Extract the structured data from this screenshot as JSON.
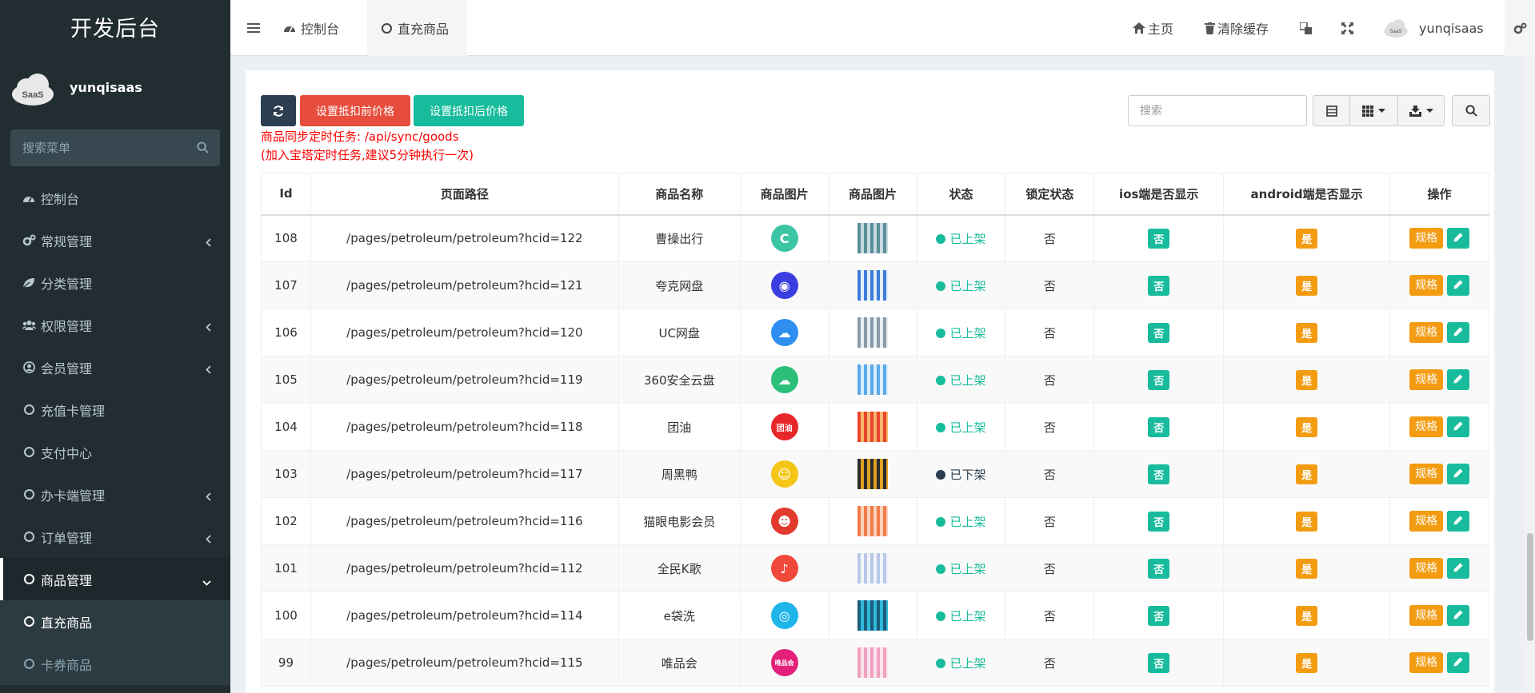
{
  "sidebar": {
    "logo": "开发后台",
    "username": "yunqisaas",
    "avatar_text": "SaaS",
    "search_placeholder": "搜索菜单",
    "items": [
      {
        "label": "控制台",
        "icon": "dashboard-icon",
        "chevron": false
      },
      {
        "label": "常规管理",
        "icon": "cogs-icon",
        "chevron": "left"
      },
      {
        "label": "分类管理",
        "icon": "leaf-icon",
        "chevron": false
      },
      {
        "label": "权限管理",
        "icon": "group-icon",
        "chevron": "left"
      },
      {
        "label": "会员管理",
        "icon": "user-circle-icon",
        "chevron": "left"
      },
      {
        "label": "充值卡管理",
        "icon": "circle-icon",
        "chevron": false
      },
      {
        "label": "支付中心",
        "icon": "circle-icon",
        "chevron": false
      },
      {
        "label": "办卡端管理",
        "icon": "circle-icon",
        "chevron": "left"
      },
      {
        "label": "订单管理",
        "icon": "circle-icon",
        "chevron": "left"
      },
      {
        "label": "商品管理",
        "icon": "circle-icon",
        "chevron": "down",
        "active": true
      },
      {
        "label": "直充商品",
        "icon": "circle-icon",
        "chevron": false,
        "sub": true,
        "current": true
      },
      {
        "label": "卡券商品",
        "icon": "circle-icon",
        "chevron": false,
        "sub": true
      }
    ]
  },
  "header": {
    "tabs": [
      {
        "label": "控制台",
        "icon": "dashboard-icon"
      },
      {
        "label": "直充商品",
        "icon": "circle-icon",
        "active": true
      }
    ],
    "home_label": "主页",
    "clear_cache_label": "清除缓存",
    "username": "yunqisaas"
  },
  "toolbar": {
    "set_before_label": "设置抵扣前价格",
    "set_after_label": "设置抵扣后价格",
    "note_line1": "商品同步定时任务: /api/sync/goods",
    "note_line2": "(加入宝塔定时任务,建议5分钟执行一次)",
    "search_placeholder": "搜索"
  },
  "table": {
    "headers": [
      "Id",
      "页面路径",
      "商品名称",
      "商品图片",
      "商品图片",
      "状态",
      "锁定状态",
      "ios端是否显示",
      "android端是否显示",
      "操作"
    ],
    "spec_label": "规格",
    "rows": [
      {
        "id": "108",
        "path": "/pages/petroleum/petroleum?hcid=122",
        "name": "曹操出行",
        "logo_color": "#3cc5a5",
        "logo_text": "C",
        "thumb": [
          "#5a8f9a",
          "#c9d9e0"
        ],
        "status": "已上架",
        "status_color": "#18bc9c",
        "locked": "否",
        "ios": "否",
        "android": "是"
      },
      {
        "id": "107",
        "path": "/pages/petroleum/petroleum?hcid=121",
        "name": "夸克网盘",
        "logo_color": "#3a3ee0",
        "logo_text": "◉",
        "thumb": [
          "#3d7bd9",
          "#e3eefb"
        ],
        "status": "已上架",
        "status_color": "#18bc9c",
        "locked": "否",
        "ios": "否",
        "android": "是"
      },
      {
        "id": "106",
        "path": "/pages/petroleum/petroleum?hcid=120",
        "name": "UC网盘",
        "logo_color": "#2f8ff0",
        "logo_text": "☁",
        "thumb": [
          "#8a99a8",
          "#e6edf3"
        ],
        "status": "已上架",
        "status_color": "#18bc9c",
        "locked": "否",
        "ios": "否",
        "android": "是"
      },
      {
        "id": "105",
        "path": "/pages/petroleum/petroleum?hcid=119",
        "name": "360安全云盘",
        "logo_color": "#2bbf7a",
        "logo_text": "☁",
        "thumb": [
          "#5aa9e8",
          "#dbeefc"
        ],
        "status": "已上架",
        "status_color": "#18bc9c",
        "locked": "否",
        "ios": "否",
        "android": "是"
      },
      {
        "id": "104",
        "path": "/pages/petroleum/petroleum?hcid=118",
        "name": "团油",
        "logo_color": "#e8272b",
        "logo_text": "团油",
        "thumb": [
          "#e8442c",
          "#f7b56b"
        ],
        "status": "已上架",
        "status_color": "#18bc9c",
        "locked": "否",
        "ios": "否",
        "android": "是"
      },
      {
        "id": "103",
        "path": "/pages/petroleum/petroleum?hcid=117",
        "name": "周黑鸭",
        "logo_color": "#f5c518",
        "logo_text": "☺",
        "thumb": [
          "#2a2a2a",
          "#e0a020"
        ],
        "status": "已下架",
        "status_color": "#2c3e50",
        "locked": "否",
        "ios": "否",
        "android": "是"
      },
      {
        "id": "102",
        "path": "/pages/petroleum/petroleum?hcid=116",
        "name": "猫眼电影会员",
        "logo_color": "#e33a2e",
        "logo_text": "☻",
        "thumb": [
          "#f07a4a",
          "#fbd2b8"
        ],
        "status": "已上架",
        "status_color": "#18bc9c",
        "locked": "否",
        "ios": "否",
        "android": "是"
      },
      {
        "id": "101",
        "path": "/pages/petroleum/petroleum?hcid=112",
        "name": "全民K歌",
        "logo_color": "#f0483a",
        "logo_text": "♪",
        "thumb": [
          "#b8c8e8",
          "#f2f4fb"
        ],
        "status": "已上架",
        "status_color": "#18bc9c",
        "locked": "否",
        "ios": "否",
        "android": "是"
      },
      {
        "id": "100",
        "path": "/pages/petroleum/petroleum?hcid=114",
        "name": "e袋洗",
        "logo_color": "#1fb5e8",
        "logo_text": "◎",
        "thumb": [
          "#1a5c7a",
          "#2fb8d8"
        ],
        "status": "已上架",
        "status_color": "#18bc9c",
        "locked": "否",
        "ios": "否",
        "android": "是"
      },
      {
        "id": "99",
        "path": "/pages/petroleum/petroleum?hcid=115",
        "name": "唯品会",
        "logo_color": "#e4207a",
        "logo_text": "唯品会",
        "thumb": [
          "#f0a0c0",
          "#fbe3ec"
        ],
        "status": "已上架",
        "status_color": "#18bc9c",
        "locked": "否",
        "ios": "否",
        "android": "是"
      }
    ]
  },
  "colors": {
    "green": "#18bc9c",
    "orange": "#f39c12",
    "red": "#e74c3c",
    "dark": "#2c3e50"
  }
}
